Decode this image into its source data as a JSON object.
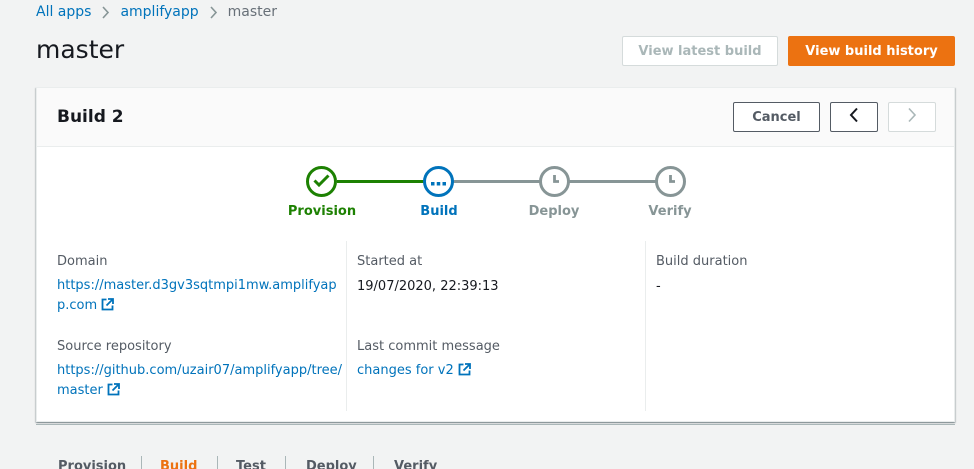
{
  "breadcrumb": {
    "items": [
      "All apps",
      "amplifyapp"
    ],
    "current": "master"
  },
  "page": {
    "title": "master"
  },
  "header_actions": {
    "view_latest_build": "View latest build",
    "view_build_history": "View build history"
  },
  "build": {
    "title": "Build 2",
    "cancel_label": "Cancel",
    "prev_icon": "chevron-left-icon",
    "next_icon": "chevron-right-icon"
  },
  "steps": [
    {
      "label": "Provision",
      "state": "complete",
      "icon": "check-icon",
      "color": "#1d8102"
    },
    {
      "label": "Build",
      "state": "in-progress",
      "icon": "ellipsis-icon",
      "color": "#0073bb"
    },
    {
      "label": "Deploy",
      "state": "pending",
      "icon": "clock-icon",
      "color": "#879596"
    },
    {
      "label": "Verify",
      "state": "pending",
      "icon": "clock-icon",
      "color": "#879596"
    }
  ],
  "details": {
    "domain_label": "Domain",
    "domain_value": "https://master.d3gv3sqtmpi1mw.amplifyapp.com",
    "source_label": "Source repository",
    "source_value": "https://github.com/uzair07/amplifyapp/tree/master",
    "started_label": "Started at",
    "started_value": "19/07/2020, 22:39:13",
    "commit_label": "Last commit message",
    "commit_value": "changes for v2",
    "duration_label": "Build duration",
    "duration_value": "-"
  },
  "tabs": [
    {
      "label": "Provision",
      "active": false
    },
    {
      "label": "Build",
      "active": true
    },
    {
      "label": "Test",
      "active": false
    },
    {
      "label": "Deploy",
      "active": false
    },
    {
      "label": "Verify",
      "active": false
    }
  ],
  "colors": {
    "primary": "#ec7211",
    "link": "#0073bb",
    "success": "#1d8102",
    "pending": "#879596"
  }
}
